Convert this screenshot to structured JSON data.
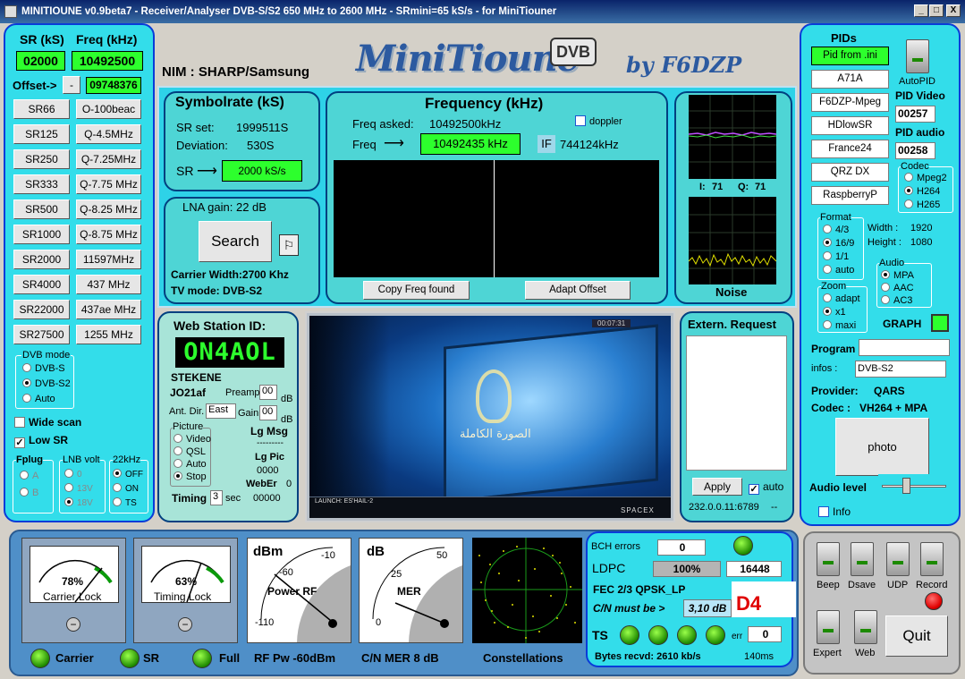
{
  "window": {
    "title": "MINITIOUNE v0.9beta7 - Receiver/Analyser DVB-S/S2 650 MHz to 2600 MHz - SRmini=65 kS/s - for MiniTiouner",
    "min": "_",
    "max": "□",
    "close": "X"
  },
  "left": {
    "sr_label": "SR (kS)",
    "freq_label": "Freq (kHz)",
    "sr_value": "02000",
    "freq_value": "10492500",
    "offset_label": "Offset->",
    "offset_sign": "-",
    "offset_value": "09748376",
    "sr_buttons": [
      "SR66",
      "SR125",
      "SR250",
      "SR333",
      "SR500",
      "SR1000",
      "SR2000",
      "SR4000",
      "SR22000",
      "SR27500"
    ],
    "freq_buttons": [
      "O-100beac",
      "Q-4.5MHz",
      "Q-7.25MHz",
      "Q-7.75 MHz",
      "Q-8.25 MHz",
      "Q-8.75 MHz",
      "11597MHz",
      "437 MHz",
      "437ae MHz",
      "1255 MHz"
    ],
    "dvb_mode": {
      "label": "DVB mode",
      "options": [
        "DVB-S",
        "DVB-S2",
        "Auto"
      ]
    },
    "wide_scan": "Wide scan",
    "low_sr": "Low SR",
    "low_sr_check": "✓",
    "fplug": {
      "label": "Fplug",
      "options": [
        "A",
        "B"
      ]
    },
    "lnb": {
      "label": "LNB volt",
      "options": [
        "0",
        "13V",
        "18V"
      ]
    },
    "khz22": {
      "label": "22kHz",
      "options": [
        "OFF",
        "ON",
        "TS"
      ]
    }
  },
  "header": {
    "nim": "NIM : SHARP/Samsung",
    "logo": "MiniTioune",
    "dvb": "DVB",
    "by": "by F6DZP"
  },
  "symbolrate": {
    "title": "Symbolrate (kS)",
    "sr_set_label": "SR set:",
    "sr_set": "1999511S",
    "deviation_label": "Deviation:",
    "deviation": "530S",
    "sr_label": "SR",
    "sr_arrow": "⟶",
    "sr_value": "2000 kS/s"
  },
  "lna": {
    "label": "LNA gain: 22 dB",
    "search": "Search",
    "carrier_width": "Carrier Width:2700 Khz",
    "tv_mode": "TV mode: DVB-S2"
  },
  "frequency": {
    "title": "Frequency (kHz)",
    "doppler": "doppler",
    "asked_label": "Freq asked:",
    "asked": "10492500kHz",
    "freq_label": "Freq",
    "freq_arrow": "⟶",
    "freq": "10492435 kHz",
    "if_label": "IF",
    "if_value": "744124kHz",
    "copy": "Copy Freq found",
    "adapt": "Adapt Offset"
  },
  "iq": {
    "i_label": "I:",
    "i": "71",
    "q_label": "Q:",
    "q": "71",
    "noise": "Noise"
  },
  "webstation": {
    "title": "Web Station ID:",
    "callsign": "ON4AOL",
    "name": "STEKENE",
    "locator": "JO21af",
    "preamp_label": "Preamp",
    "preamp": "00",
    "db1": "dB",
    "antdir_label": "Ant. Dir.",
    "antdir": "East",
    "gain_label": "Gain",
    "gain": "00",
    "db2": "dB",
    "picture": {
      "label": "Picture",
      "options": [
        "Video",
        "QSL",
        "Auto",
        "Stop"
      ]
    },
    "lgmsg": "Lg Msg",
    "dashes": "---------",
    "lgpic": "Lg Pic",
    "lgpic_val": "0000",
    "weberr": "WebEr",
    "weberr_val": "0",
    "timing_label": "Timing",
    "timing": "3",
    "sec": "sec",
    "timing_val": "00000"
  },
  "video": {
    "brand": "SPACEX",
    "caption": "LAUNCH: ES'HAIL-2",
    "arabic": "الصورة الكاملة",
    "timer": "00:07:31"
  },
  "extern": {
    "title": "Extern. Request",
    "apply": "Apply",
    "auto": "auto",
    "auto_check": "✓",
    "ip": "232.0.0.11:6789",
    "dash": "--"
  },
  "pids": {
    "title": "PIDs",
    "buttons": [
      "Pid from .ini",
      "A71A",
      "F6DZP-Mpeg",
      "HDlowSR",
      "France24",
      "QRZ DX",
      "RaspberryP"
    ],
    "autopid": "AutoPID",
    "pid_video_label": "PID Video",
    "pid_video": "00257",
    "pid_audio_label": "PID audio",
    "pid_audio": "00258",
    "codec": {
      "label": "Codec",
      "options": [
        "Mpeg2",
        "H264",
        "H265"
      ]
    },
    "format": {
      "label": "Format",
      "options": [
        "4/3",
        "16/9",
        "1/1",
        "auto"
      ]
    },
    "width_label": "Width :",
    "width": "1920",
    "height_label": "Height :",
    "height": "1080",
    "zoom": {
      "label": "Zoom",
      "options": [
        "adapt",
        "x1",
        "maxi"
      ]
    },
    "audio": {
      "label": "Audio",
      "options": [
        "MPA",
        "AAC",
        "AC3"
      ]
    },
    "graph": "GRAPH",
    "program_label": "Program",
    "program": "",
    "infos_label": "infos :",
    "infos": "DVB-S2",
    "provider_label": "Provider:",
    "provider": "QARS",
    "codec_label": "Codec :",
    "codec_val": "VH264 + MPA",
    "photo": "photo",
    "audio_level": "Audio level",
    "info": "Info"
  },
  "bottom": {
    "carrier_pct": "78%",
    "carrier_lock": "Carrier Lock",
    "timing_pct": "63%",
    "timing_lock": "Timing Lock",
    "dbm": "dBm",
    "m60": "-60",
    "m10": "-10",
    "power_rf": "Power RF",
    "m110": "-110",
    "db": "dB",
    "d25": "25",
    "d50": "50",
    "mer": "MER",
    "d0": "0",
    "led_carrier": "Carrier",
    "led_sr": "SR",
    "led_full": "Full",
    "rfpw": "RF Pw -60dBm",
    "cnmer": "C/N MER 8 dB",
    "constellations": "Constellations"
  },
  "stats": {
    "bch_label": "BCH errors",
    "bch": "0",
    "ldpc_label": "LDPC",
    "ldpc_pct": "100%",
    "ldpc_val": "16448",
    "fec": "FEC  2/3 QPSK_LP",
    "cn_label": "C/N must be  >",
    "cn_val": "3,10 dB",
    "d4": "D4",
    "ts": "TS",
    "err_label": "err",
    "err": "0",
    "bytes": "Bytes recvd:  2610 kb/s",
    "ms": "140ms"
  },
  "controls": {
    "beep": "Beep",
    "dsave": "Dsave",
    "udp": "UDP",
    "record": "Record",
    "expert": "Expert",
    "web": "Web",
    "quit": "Quit"
  }
}
